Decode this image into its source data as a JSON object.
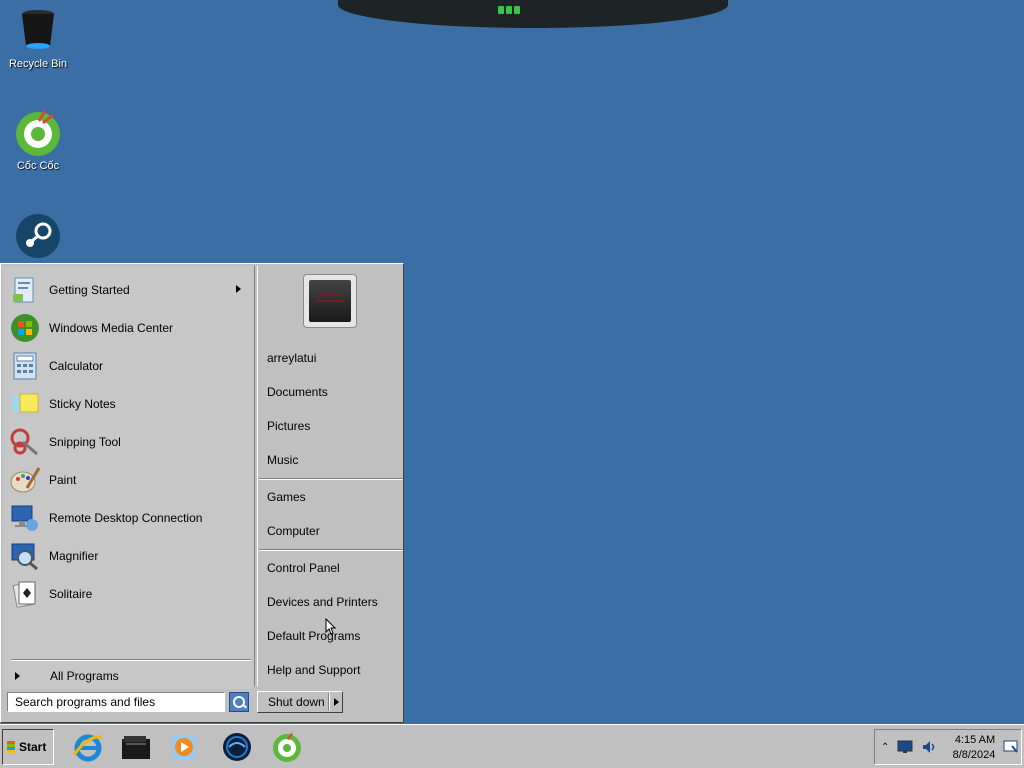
{
  "desktop": {
    "icons": [
      {
        "label": "Recycle Bin",
        "icon": "recycle-bin-icon"
      },
      {
        "label": "Cốc Cốc",
        "icon": "coccoc-browser-icon"
      },
      {
        "label": "",
        "icon": "steam-icon"
      }
    ]
  },
  "start_menu": {
    "programs": [
      {
        "label": "Getting Started",
        "icon": "getting-started-icon",
        "has_submenu": true
      },
      {
        "label": "Windows Media Center",
        "icon": "windows-media-center-icon"
      },
      {
        "label": "Calculator",
        "icon": "calculator-icon"
      },
      {
        "label": "Sticky Notes",
        "icon": "sticky-notes-icon"
      },
      {
        "label": "Snipping Tool",
        "icon": "snipping-tool-icon"
      },
      {
        "label": "Paint",
        "icon": "paint-icon"
      },
      {
        "label": "Remote Desktop Connection",
        "icon": "remote-desktop-icon"
      },
      {
        "label": "Magnifier",
        "icon": "magnifier-icon"
      },
      {
        "label": "Solitaire",
        "icon": "solitaire-icon"
      }
    ],
    "all_programs_label": "All Programs",
    "search_placeholder": "Search programs and files",
    "right_items": {
      "user": "arreylatui",
      "documents": "Documents",
      "pictures": "Pictures",
      "music": "Music",
      "games": "Games",
      "computer": "Computer",
      "control_panel": "Control Panel",
      "devices_printers": "Devices and Printers",
      "default_programs": "Default Programs",
      "help_support": "Help and Support"
    },
    "shutdown_label": "Shut down"
  },
  "taskbar": {
    "start_label": "Start",
    "pinned": [
      {
        "icon": "internet-explorer-icon"
      },
      {
        "icon": "file-explorer-icon"
      },
      {
        "icon": "windows-media-player-icon"
      },
      {
        "icon": "globe-app-icon"
      },
      {
        "icon": "coccoc-browser-icon"
      }
    ],
    "tray": {
      "time": "4:15 AM",
      "date": "8/8/2024",
      "icons": [
        "show-hidden-icons-icon",
        "network-icon",
        "volume-icon",
        "action-center-icon"
      ]
    }
  },
  "colors": {
    "desktop": "#3a6ea5",
    "menu_face": "#c0c0c0"
  }
}
